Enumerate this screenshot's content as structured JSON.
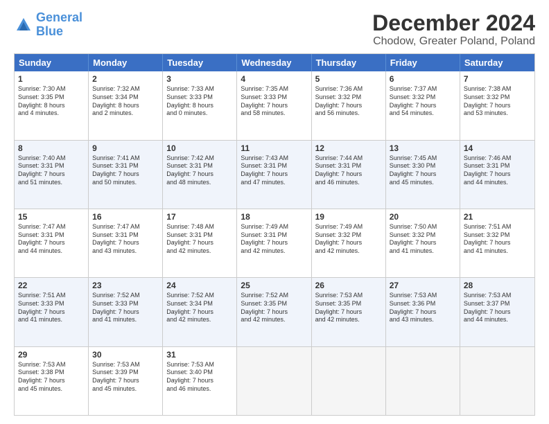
{
  "header": {
    "logo_line1": "General",
    "logo_line2": "Blue",
    "title": "December 2024",
    "subtitle": "Chodow, Greater Poland, Poland"
  },
  "weekdays": [
    "Sunday",
    "Monday",
    "Tuesday",
    "Wednesday",
    "Thursday",
    "Friday",
    "Saturday"
  ],
  "weeks": [
    [
      {
        "day": "1",
        "sunrise": "Sunrise: 7:30 AM",
        "sunset": "Sunset: 3:35 PM",
        "daylight": "Daylight: 8 hours and 4 minutes.",
        "alt": false
      },
      {
        "day": "2",
        "sunrise": "Sunrise: 7:32 AM",
        "sunset": "Sunset: 3:34 PM",
        "daylight": "Daylight: 8 hours and 2 minutes.",
        "alt": false
      },
      {
        "day": "3",
        "sunrise": "Sunrise: 7:33 AM",
        "sunset": "Sunset: 3:33 PM",
        "daylight": "Daylight: 8 hours and 0 minutes.",
        "alt": false
      },
      {
        "day": "4",
        "sunrise": "Sunrise: 7:35 AM",
        "sunset": "Sunset: 3:33 PM",
        "daylight": "Daylight: 7 hours and 58 minutes.",
        "alt": false
      },
      {
        "day": "5",
        "sunrise": "Sunrise: 7:36 AM",
        "sunset": "Sunset: 3:32 PM",
        "daylight": "Daylight: 7 hours and 56 minutes.",
        "alt": false
      },
      {
        "day": "6",
        "sunrise": "Sunrise: 7:37 AM",
        "sunset": "Sunset: 3:32 PM",
        "daylight": "Daylight: 7 hours and 54 minutes.",
        "alt": false
      },
      {
        "day": "7",
        "sunrise": "Sunrise: 7:38 AM",
        "sunset": "Sunset: 3:32 PM",
        "daylight": "Daylight: 7 hours and 53 minutes.",
        "alt": false
      }
    ],
    [
      {
        "day": "8",
        "sunrise": "Sunrise: 7:40 AM",
        "sunset": "Sunset: 3:31 PM",
        "daylight": "Daylight: 7 hours and 51 minutes.",
        "alt": true
      },
      {
        "day": "9",
        "sunrise": "Sunrise: 7:41 AM",
        "sunset": "Sunset: 3:31 PM",
        "daylight": "Daylight: 7 hours and 50 minutes.",
        "alt": true
      },
      {
        "day": "10",
        "sunrise": "Sunrise: 7:42 AM",
        "sunset": "Sunset: 3:31 PM",
        "daylight": "Daylight: 7 hours and 48 minutes.",
        "alt": true
      },
      {
        "day": "11",
        "sunrise": "Sunrise: 7:43 AM",
        "sunset": "Sunset: 3:31 PM",
        "daylight": "Daylight: 7 hours and 47 minutes.",
        "alt": true
      },
      {
        "day": "12",
        "sunrise": "Sunrise: 7:44 AM",
        "sunset": "Sunset: 3:31 PM",
        "daylight": "Daylight: 7 hours and 46 minutes.",
        "alt": true
      },
      {
        "day": "13",
        "sunrise": "Sunrise: 7:45 AM",
        "sunset": "Sunset: 3:30 PM",
        "daylight": "Daylight: 7 hours and 45 minutes.",
        "alt": true
      },
      {
        "day": "14",
        "sunrise": "Sunrise: 7:46 AM",
        "sunset": "Sunset: 3:31 PM",
        "daylight": "Daylight: 7 hours and 44 minutes.",
        "alt": true
      }
    ],
    [
      {
        "day": "15",
        "sunrise": "Sunrise: 7:47 AM",
        "sunset": "Sunset: 3:31 PM",
        "daylight": "Daylight: 7 hours and 44 minutes.",
        "alt": false
      },
      {
        "day": "16",
        "sunrise": "Sunrise: 7:47 AM",
        "sunset": "Sunset: 3:31 PM",
        "daylight": "Daylight: 7 hours and 43 minutes.",
        "alt": false
      },
      {
        "day": "17",
        "sunrise": "Sunrise: 7:48 AM",
        "sunset": "Sunset: 3:31 PM",
        "daylight": "Daylight: 7 hours and 42 minutes.",
        "alt": false
      },
      {
        "day": "18",
        "sunrise": "Sunrise: 7:49 AM",
        "sunset": "Sunset: 3:31 PM",
        "daylight": "Daylight: 7 hours and 42 minutes.",
        "alt": false
      },
      {
        "day": "19",
        "sunrise": "Sunrise: 7:49 AM",
        "sunset": "Sunset: 3:32 PM",
        "daylight": "Daylight: 7 hours and 42 minutes.",
        "alt": false
      },
      {
        "day": "20",
        "sunrise": "Sunrise: 7:50 AM",
        "sunset": "Sunset: 3:32 PM",
        "daylight": "Daylight: 7 hours and 41 minutes.",
        "alt": false
      },
      {
        "day": "21",
        "sunrise": "Sunrise: 7:51 AM",
        "sunset": "Sunset: 3:32 PM",
        "daylight": "Daylight: 7 hours and 41 minutes.",
        "alt": false
      }
    ],
    [
      {
        "day": "22",
        "sunrise": "Sunrise: 7:51 AM",
        "sunset": "Sunset: 3:33 PM",
        "daylight": "Daylight: 7 hours and 41 minutes.",
        "alt": true
      },
      {
        "day": "23",
        "sunrise": "Sunrise: 7:52 AM",
        "sunset": "Sunset: 3:33 PM",
        "daylight": "Daylight: 7 hours and 41 minutes.",
        "alt": true
      },
      {
        "day": "24",
        "sunrise": "Sunrise: 7:52 AM",
        "sunset": "Sunset: 3:34 PM",
        "daylight": "Daylight: 7 hours and 42 minutes.",
        "alt": true
      },
      {
        "day": "25",
        "sunrise": "Sunrise: 7:52 AM",
        "sunset": "Sunset: 3:35 PM",
        "daylight": "Daylight: 7 hours and 42 minutes.",
        "alt": true
      },
      {
        "day": "26",
        "sunrise": "Sunrise: 7:53 AM",
        "sunset": "Sunset: 3:35 PM",
        "daylight": "Daylight: 7 hours and 42 minutes.",
        "alt": true
      },
      {
        "day": "27",
        "sunrise": "Sunrise: 7:53 AM",
        "sunset": "Sunset: 3:36 PM",
        "daylight": "Daylight: 7 hours and 43 minutes.",
        "alt": true
      },
      {
        "day": "28",
        "sunrise": "Sunrise: 7:53 AM",
        "sunset": "Sunset: 3:37 PM",
        "daylight": "Daylight: 7 hours and 44 minutes.",
        "alt": true
      }
    ],
    [
      {
        "day": "29",
        "sunrise": "Sunrise: 7:53 AM",
        "sunset": "Sunset: 3:38 PM",
        "daylight": "Daylight: 7 hours and 45 minutes.",
        "alt": false
      },
      {
        "day": "30",
        "sunrise": "Sunrise: 7:53 AM",
        "sunset": "Sunset: 3:39 PM",
        "daylight": "Daylight: 7 hours and 45 minutes.",
        "alt": false
      },
      {
        "day": "31",
        "sunrise": "Sunrise: 7:53 AM",
        "sunset": "Sunset: 3:40 PM",
        "daylight": "Daylight: 7 hours and 46 minutes.",
        "alt": false
      },
      null,
      null,
      null,
      null
    ]
  ]
}
